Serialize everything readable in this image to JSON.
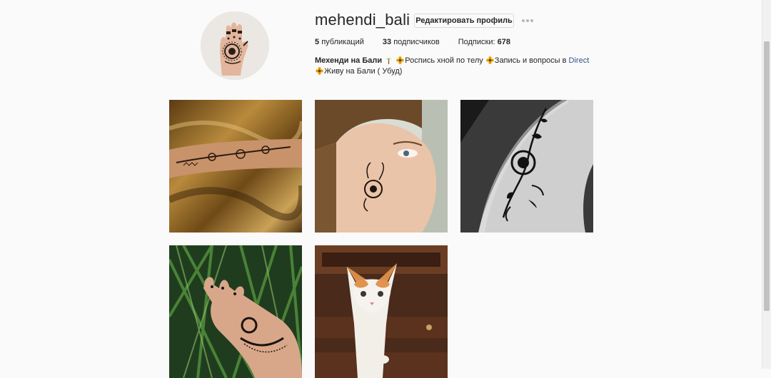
{
  "profile": {
    "username": "mehendi_bali",
    "edit_button": "Редактировать профиль",
    "stats": {
      "posts_count": "5",
      "posts_label": "публикаций",
      "followers_count": "33",
      "followers_label": "подписчиков",
      "following_label": "Подписки:",
      "following_count": "678"
    },
    "bio": {
      "name": "Мехенди на Бали",
      "part1": "Роспись хной по телу",
      "part2": "Запись и вопросы в ",
      "direct": "Direct",
      "part3": "Живу на Бали ( Убуд)"
    }
  },
  "posts": [
    {
      "subject": "henna-on-leg-photo"
    },
    {
      "subject": "henna-on-face-photo"
    },
    {
      "subject": "henna-flower-on-arm-photo"
    },
    {
      "subject": "henna-on-hand-photo"
    },
    {
      "subject": "kitten-photo"
    }
  ],
  "colors": {
    "background": "#fafafa",
    "text": "#262626",
    "link": "#385185",
    "border": "#dbdbdb"
  }
}
